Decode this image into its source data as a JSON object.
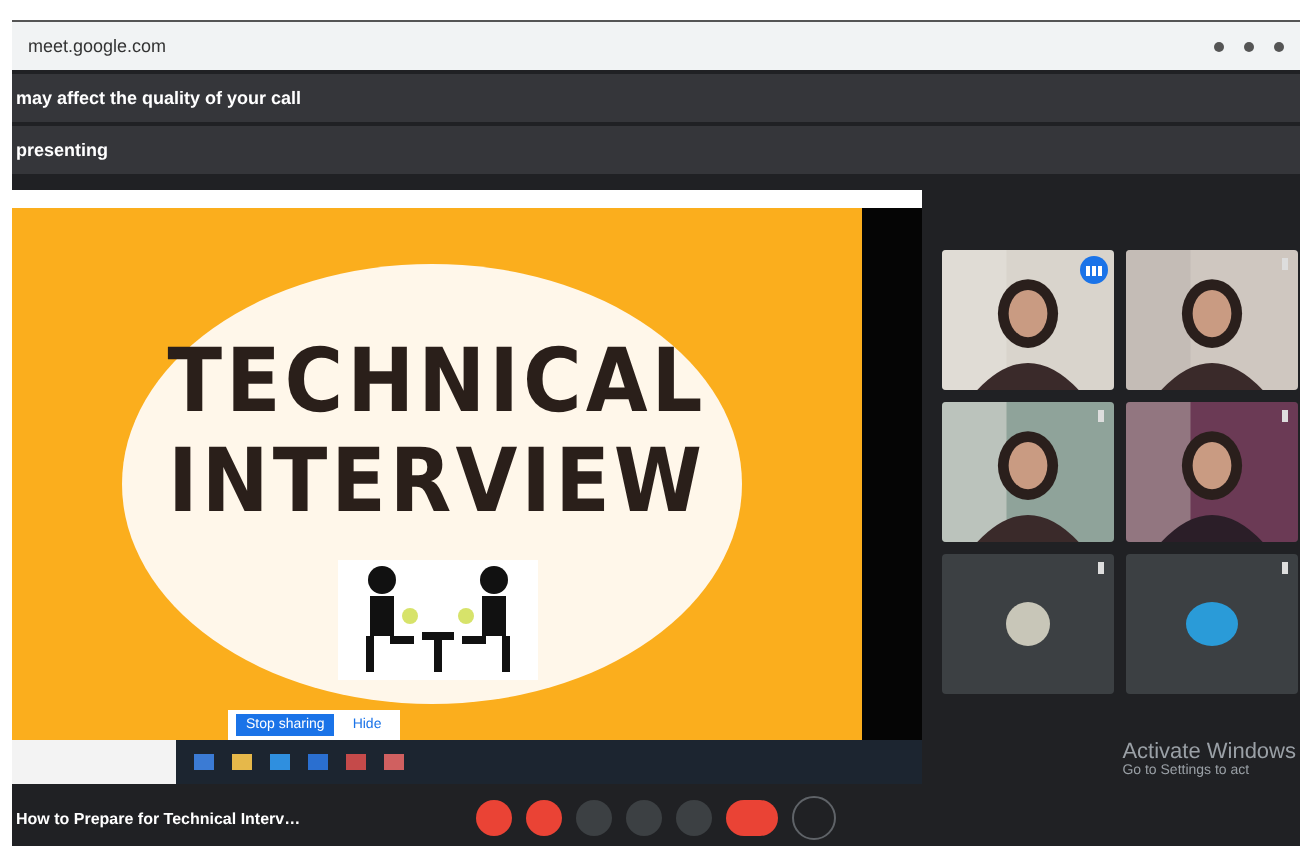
{
  "address_bar": {
    "url": "meet.google.com"
  },
  "banner": {
    "text": "may affect the quality of your call"
  },
  "status_bar": {
    "text": "presenting"
  },
  "slide": {
    "title_lines": [
      "TECHNICAL",
      "INTERVIEW"
    ]
  },
  "share_bar": {
    "buttons": [
      {
        "label": "Stop sharing",
        "kind": "primary"
      },
      {
        "label": "Hide",
        "kind": "link"
      }
    ]
  },
  "participants": [
    {
      "kind": "video",
      "speaking": true
    },
    {
      "kind": "video",
      "speaking": false
    },
    {
      "kind": "video",
      "speaking": false
    },
    {
      "kind": "video",
      "speaking": false
    },
    {
      "kind": "avatar",
      "speaking": false
    },
    {
      "kind": "avatar",
      "speaking": false
    }
  ],
  "meeting_title": "How to Prepare for Technical Interv…",
  "controls": [
    {
      "kind": "danger"
    },
    {
      "kind": "danger"
    },
    {
      "kind": "plain"
    },
    {
      "kind": "plain"
    },
    {
      "kind": "plain"
    },
    {
      "kind": "end"
    },
    {
      "kind": "outline"
    }
  ],
  "activation_notice": {
    "title": "Activate Windows",
    "text": "Go to Settings to act"
  }
}
